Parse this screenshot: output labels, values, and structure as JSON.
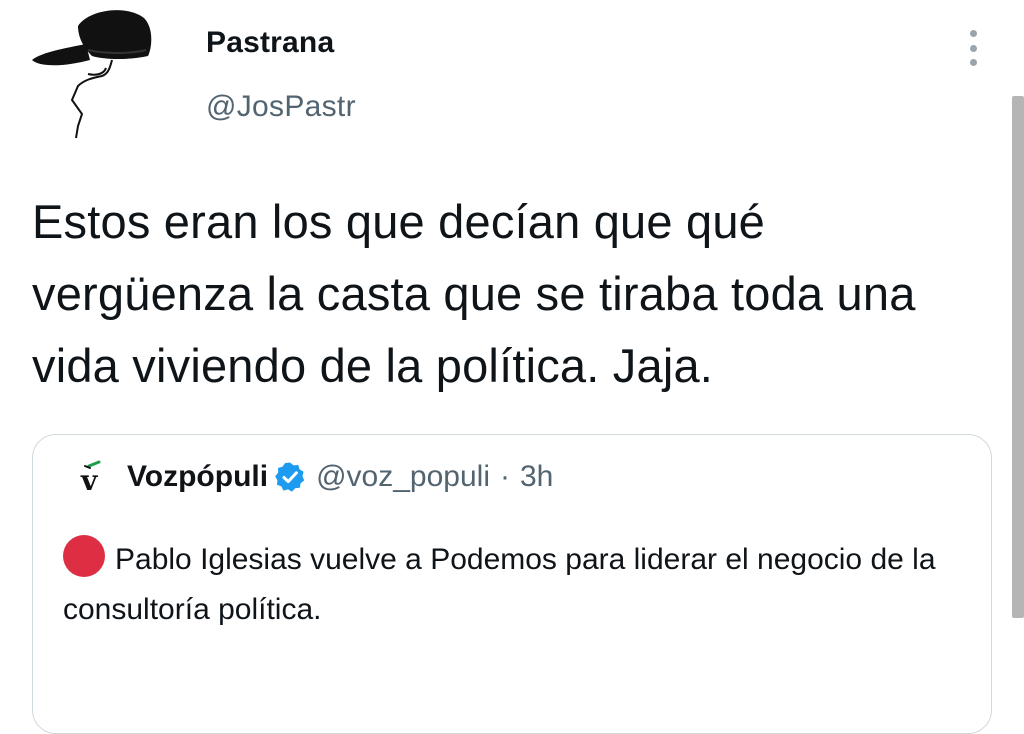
{
  "tweet": {
    "author": {
      "display_name": "Pastrana",
      "handle": "@JosPastr",
      "avatar_icon": "black-cap-icon"
    },
    "text": "Estos eran los que decían que qué vergüenza la casta que se tiraba toda una vida viviendo de la política. Jaja.",
    "more_icon": "more-vertical-icon"
  },
  "quoted_tweet": {
    "author": {
      "display_name": "Vozpópuli",
      "handle": "@voz_populi",
      "avatar_icon": "vozpopuli-logo-icon",
      "verified": true
    },
    "separator": "·",
    "time": "3h",
    "emoji": "red-circle-icon",
    "text": "Pablo Iglesias vuelve a Podemos para liderar el negocio de la consultoría política."
  },
  "colors": {
    "text_primary": "#0f1419",
    "text_secondary": "#536471",
    "verified_blue": "#1d9bf0",
    "red_circle": "#dd2e44",
    "card_border": "#cfd9de"
  }
}
